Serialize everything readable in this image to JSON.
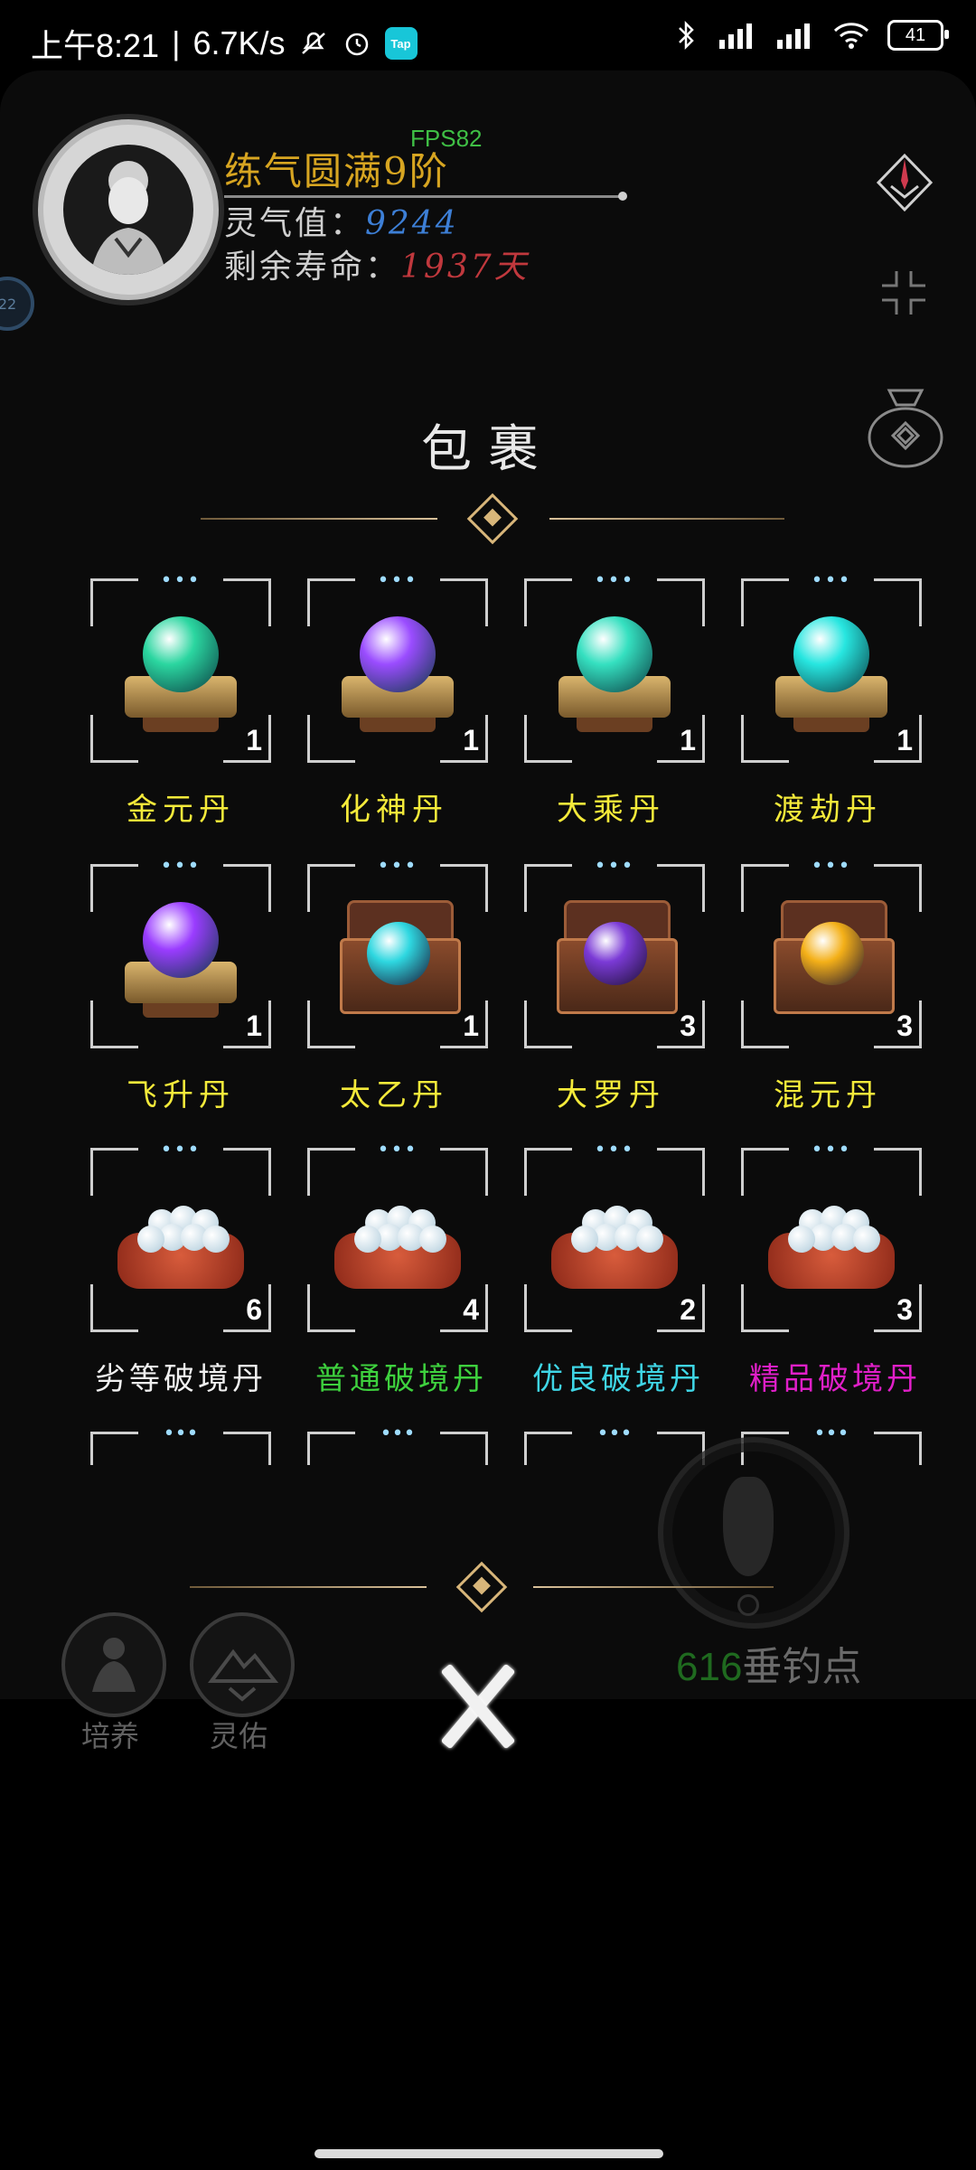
{
  "status_bar": {
    "time": "上午8:21",
    "speed": "6.7K/s",
    "tap_badge": "Tap",
    "battery": "41"
  },
  "header": {
    "realm": "练气圆满9阶",
    "fps": "FPS82",
    "spirit_label": "灵气值：",
    "spirit_value": "9244",
    "life_label": "剩余寿命：",
    "life_value": "1937天",
    "left_bubble": "22"
  },
  "bag": {
    "title": "包裹",
    "items": [
      {
        "name": "金元丹",
        "count": "1",
        "orb": "#2bd6a0",
        "type": "stand",
        "label_color": "yellow"
      },
      {
        "name": "化神丹",
        "count": "1",
        "orb": "#9a4cff",
        "type": "stand",
        "label_color": "yellow"
      },
      {
        "name": "大乘丹",
        "count": "1",
        "orb": "#35e0c0",
        "type": "stand",
        "label_color": "yellow"
      },
      {
        "name": "渡劫丹",
        "count": "1",
        "orb": "#27e6e0",
        "type": "stand",
        "label_color": "yellow"
      },
      {
        "name": "飞升丹",
        "count": "1",
        "orb": "#9a3cff",
        "type": "stand",
        "label_color": "yellow"
      },
      {
        "name": "太乙丹",
        "count": "1",
        "orb": "#2ed7e0",
        "type": "chest",
        "label_color": "yellow"
      },
      {
        "name": "大罗丹",
        "count": "3",
        "orb": "#7b3ad6",
        "type": "chest",
        "label_color": "yellow"
      },
      {
        "name": "混元丹",
        "count": "3",
        "orb": "#f4b018",
        "type": "chest",
        "label_color": "yellow"
      },
      {
        "name": "劣等破境丹",
        "count": "6",
        "type": "cushion",
        "label_color": "white"
      },
      {
        "name": "普通破境丹",
        "count": "4",
        "type": "cushion",
        "label_color": "green"
      },
      {
        "name": "优良破境丹",
        "count": "2",
        "type": "cushion",
        "label_color": "cyan"
      },
      {
        "name": "精品破境丹",
        "count": "3",
        "type": "cushion",
        "label_color": "magenta"
      }
    ],
    "slot_dots": "•••"
  },
  "fishing": {
    "points_value": "616",
    "points_label": "垂钓点"
  },
  "bottom_buttons": [
    {
      "label": "培养"
    },
    {
      "label": "灵佑"
    }
  ],
  "colors": {
    "realm": "#d7a521",
    "spirit": "#3d7fd6",
    "life": "#c0383d",
    "fps": "#3fbf45",
    "divider": "#d8b67a"
  }
}
